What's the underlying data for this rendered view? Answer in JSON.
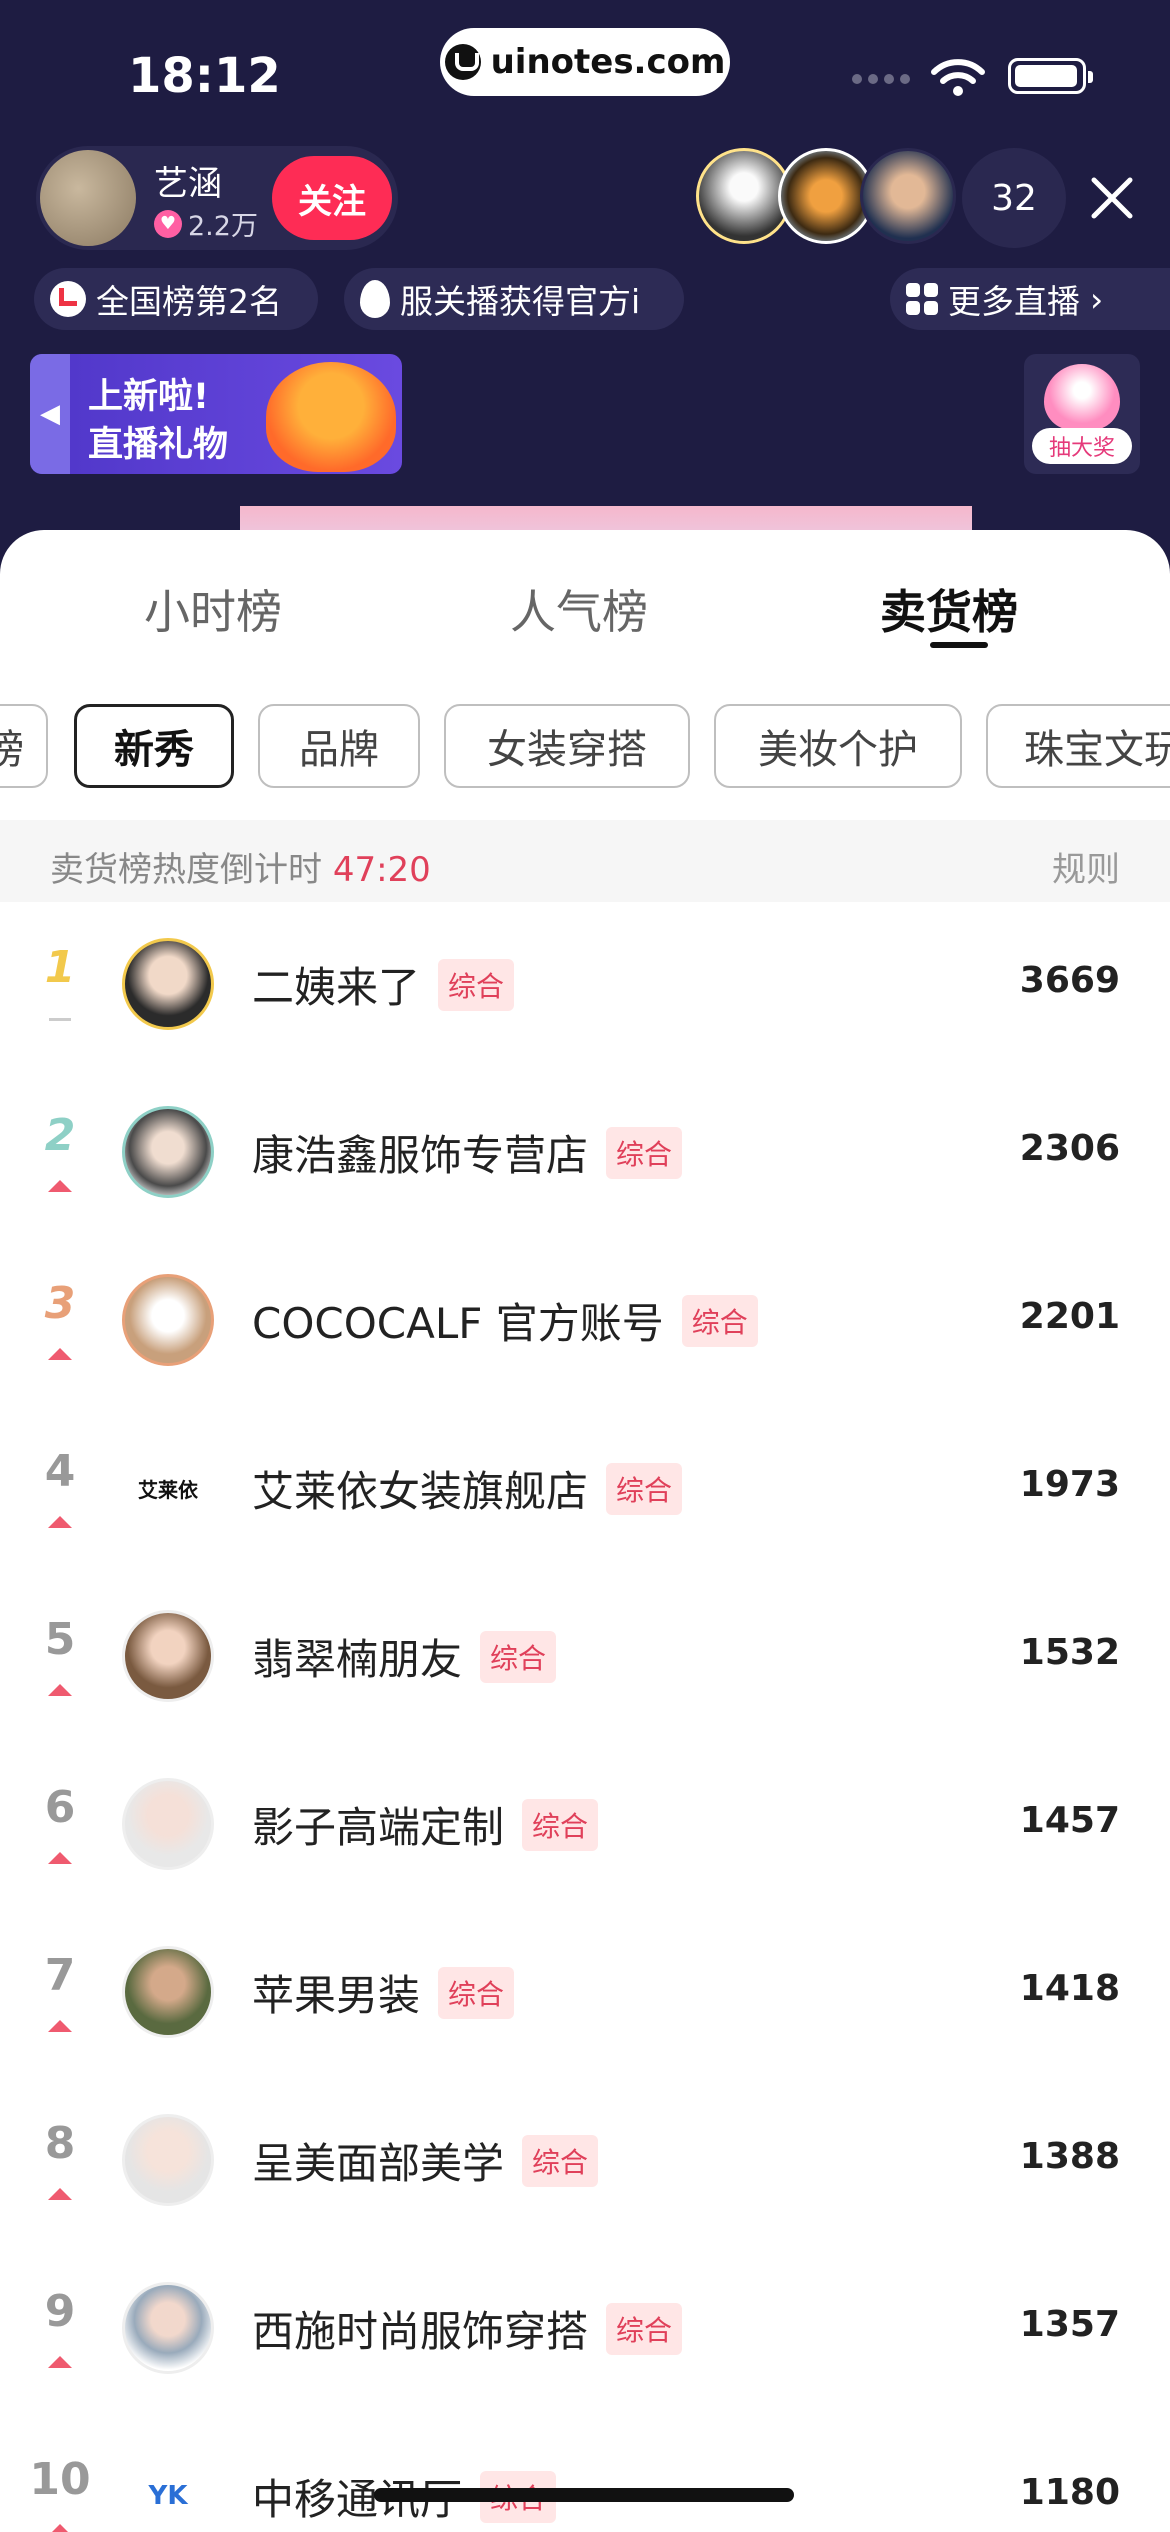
{
  "status_bar": {
    "time": "18:12",
    "url": "uinotes.com"
  },
  "host": {
    "name": "艺涵",
    "fans": "2.2万",
    "follow_label": "关注"
  },
  "viewers": {
    "count": "32"
  },
  "chips": {
    "rank": "全国榜第2名",
    "notice": "服关播获得官方i",
    "more": "更多直播"
  },
  "gift_banner": {
    "line1": "上新啦!",
    "line2": "直播礼物"
  },
  "lottery": {
    "label": "抽大奖"
  },
  "tabs": [
    "小时榜",
    "人气榜",
    "卖货榜"
  ],
  "active_tab": "卖货榜",
  "categories": [
    "榜",
    "新秀",
    "品牌",
    "女装穿搭",
    "美妆个护",
    "珠宝文玩"
  ],
  "active_category": "新秀",
  "countdown": {
    "label": "卖货榜热度倒计时 ",
    "time": "47:20",
    "rules": "规则"
  },
  "ranking": [
    {
      "rank": "1",
      "name": "二姨来了",
      "tag": "综合",
      "score": "3669",
      "trend": "flat"
    },
    {
      "rank": "2",
      "name": "康浩鑫服饰专营店",
      "tag": "综合",
      "score": "2306",
      "trend": "up"
    },
    {
      "rank": "3",
      "name": "COCOCALF 官方账号",
      "tag": "综合",
      "score": "2201",
      "trend": "up"
    },
    {
      "rank": "4",
      "name": "艾莱依女装旗舰店",
      "tag": "综合",
      "score": "1973",
      "trend": "up",
      "avatar_text": "艾莱依"
    },
    {
      "rank": "5",
      "name": "翡翠楠朋友",
      "tag": "综合",
      "score": "1532",
      "trend": "up"
    },
    {
      "rank": "6",
      "name": "影子高端定制",
      "tag": "综合",
      "score": "1457",
      "trend": "up"
    },
    {
      "rank": "7",
      "name": "苹果男装",
      "tag": "综合",
      "score": "1418",
      "trend": "up"
    },
    {
      "rank": "8",
      "name": "呈美面部美学",
      "tag": "综合",
      "score": "1388",
      "trend": "up"
    },
    {
      "rank": "9",
      "name": "西施时尚服饰穿搭",
      "tag": "综合",
      "score": "1357",
      "trend": "up"
    },
    {
      "rank": "10",
      "name": "中移通讯厅",
      "tag": "综合",
      "score": "1180",
      "trend": "up",
      "avatar_text": "YK"
    }
  ],
  "colors": {
    "accent": "#fe2c55",
    "countdown": "#e0405a",
    "header_bg": "#1e1c42"
  }
}
